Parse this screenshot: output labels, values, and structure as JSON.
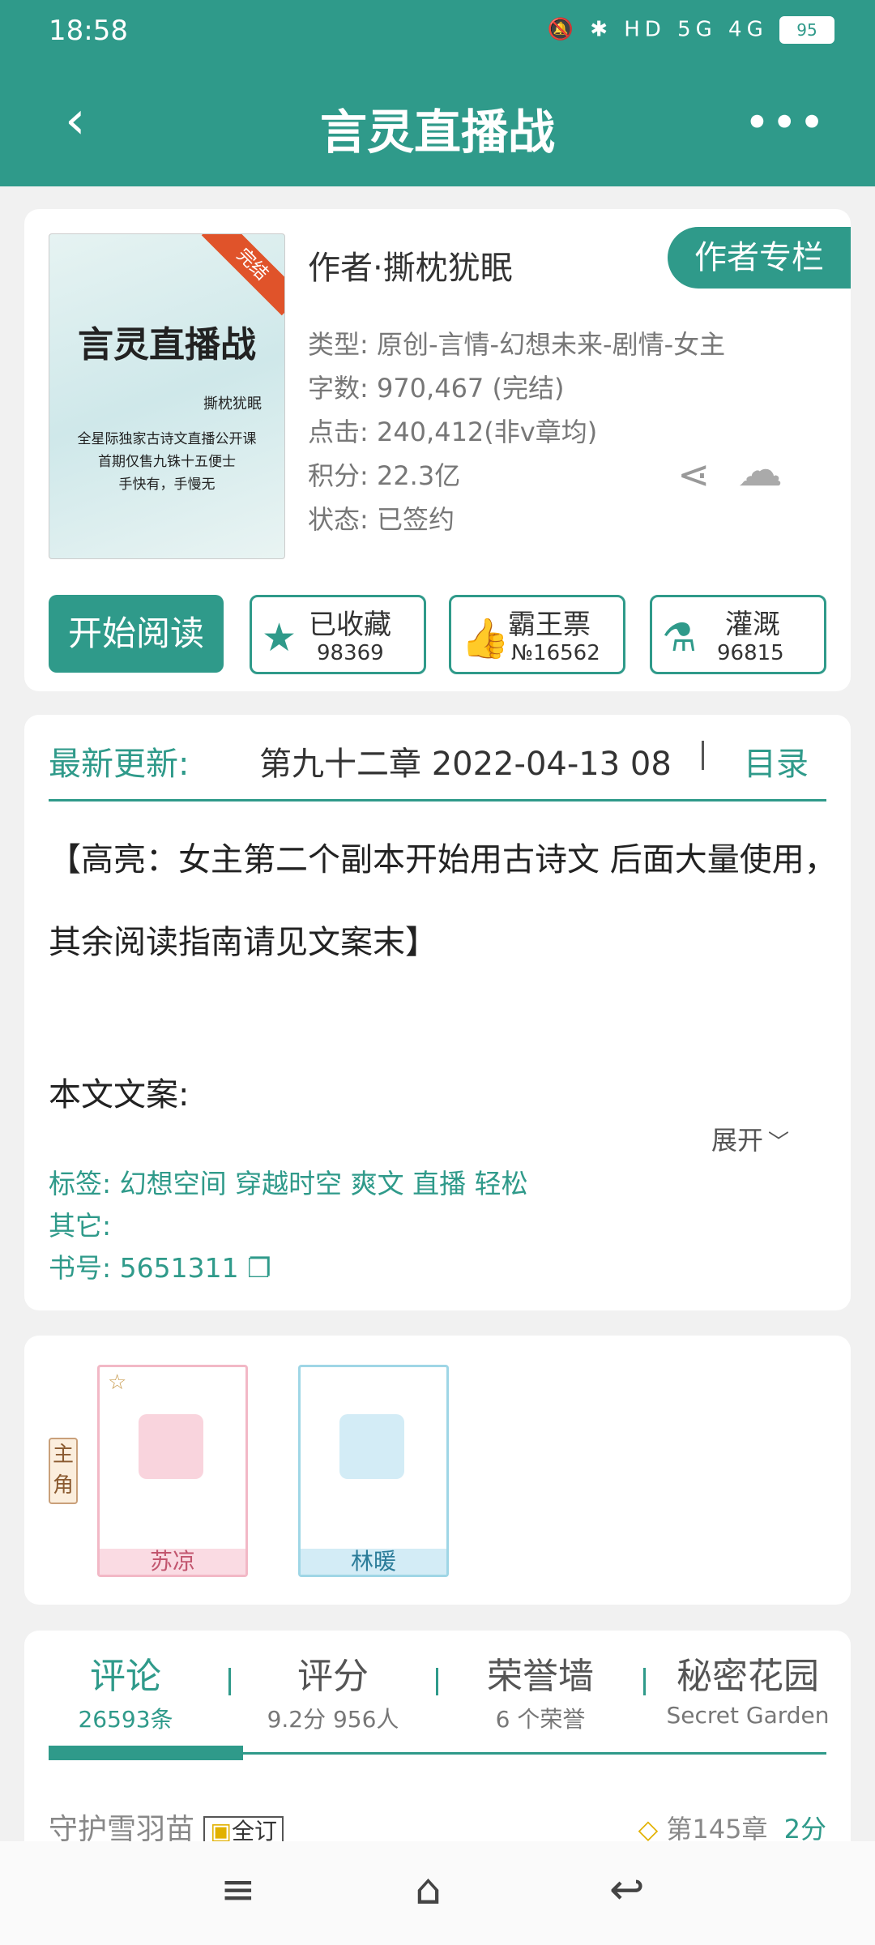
{
  "status": {
    "time": "18:58",
    "icons": "🔕 ✱ HD 5G 4G",
    "battery": "95"
  },
  "header": {
    "back": "‹",
    "title": "言灵直播战",
    "more": "•••"
  },
  "book": {
    "cover": {
      "title": "言灵直播战",
      "author": "撕枕犹眠",
      "badge": "完结",
      "line1": "全星际独家古诗文直播公开课",
      "line2": "首期仅售九铢十五便士",
      "line3": "手快有，手慢无"
    },
    "author": "作者·撕枕犹眠",
    "author_column": "作者专栏",
    "type": "类型: 原创-言情-幻想未来-剧情-女主",
    "words": "字数: 970,467 (完结)",
    "clicks": "点击: 240,412(非v章均)",
    "points": "积分: 22.3亿",
    "state": "状态: 已签约",
    "start_read": "开始阅读",
    "collect": {
      "label": "已收藏",
      "count": "98369"
    },
    "vote": {
      "label": "霸王票",
      "count": "№16562"
    },
    "water": {
      "label": "灌溉",
      "count": "96815"
    }
  },
  "update": {
    "label": "最新更新:",
    "chapter": "第九十二章  2022-04-13 08",
    "toc": "目录",
    "intro": "【高亮：女主第二个副本开始用古诗文 后面大量使用，其余阅读指南请见文案末】",
    "intro_head": "本文文案:",
    "expand": "展开",
    "tags": "标签: 幻想空间 穿越时空 爽文 直播 轻松",
    "other": "其它:",
    "book_no": "书号: 5651311"
  },
  "characters": {
    "role_tag": "主角",
    "c1": "苏凉",
    "c2": "林暖"
  },
  "comments": {
    "tabs": [
      {
        "t": "评论",
        "s": "26593条"
      },
      {
        "t": "评分",
        "s": "9.2分 956人"
      },
      {
        "t": "荣誉墙",
        "s": "6 个荣誉"
      },
      {
        "t": "秘密花园",
        "s": "Secret Garden"
      }
    ],
    "first_user": "守护雪羽苗",
    "first_badge": "全订",
    "first_chapter": "第145章",
    "first_score": "2分"
  },
  "nav": {
    "menu": "≡",
    "home": "⌂",
    "back": "↩"
  },
  "colors": {
    "accent": "#2f9a8a"
  }
}
